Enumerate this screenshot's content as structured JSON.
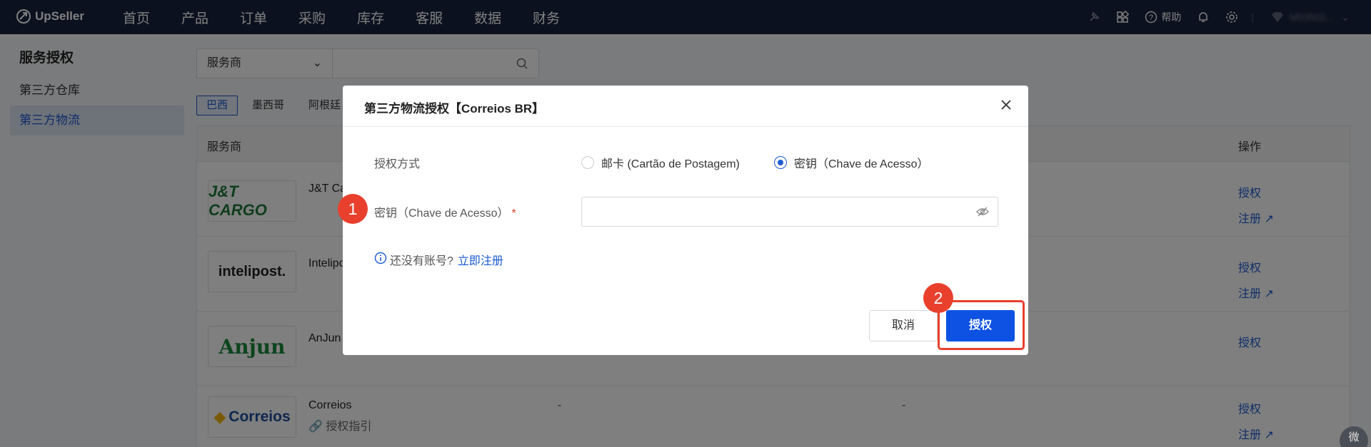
{
  "app": {
    "brand": "UpSeller"
  },
  "topnav": {
    "items": [
      "首页",
      "产品",
      "订单",
      "采购",
      "库存",
      "客服",
      "数据",
      "财务"
    ],
    "help_label": "帮助",
    "account_name": "M03502..."
  },
  "sidebar": {
    "title": "服务授权",
    "items": [
      {
        "label": "第三方仓库",
        "active": false
      },
      {
        "label": "第三方物流",
        "active": true
      }
    ]
  },
  "filter": {
    "select_value": "服务商",
    "search_placeholder": ""
  },
  "country_tabs": [
    "巴西",
    "墨西哥",
    "阿根廷"
  ],
  "table": {
    "headers": {
      "provider": "服务商",
      "operation": "操作"
    },
    "rows": [
      {
        "logo_text": "J&T CARGO",
        "name": "J&T Ca",
        "ops": [
          "授权",
          "注册"
        ]
      },
      {
        "logo_text": "intelipost.",
        "name": "Intelipos",
        "ops": [
          "授权",
          "注册"
        ]
      },
      {
        "logo_text": "Anjun",
        "name": "AnJun",
        "ops": [
          "授权"
        ]
      },
      {
        "logo_text": "Correios",
        "name": "Correios",
        "guide": "授权指引",
        "col2": "-",
        "col3": "-",
        "ops": [
          "授权",
          "注册"
        ]
      }
    ]
  },
  "modal": {
    "title": "第三方物流授权【Correios BR】",
    "auth_method_label": "授权方式",
    "options": [
      {
        "label": "邮卡 (Cartão de Postagem)",
        "selected": false
      },
      {
        "label": "密钥（Chave de Acesso）",
        "selected": true
      }
    ],
    "key_label": "密钥（Chave de Acesso）",
    "required_mark": "*",
    "key_value": "",
    "hint_text": "还没有账号?",
    "hint_link": "立即注册",
    "cancel_label": "取消",
    "submit_label": "授权"
  },
  "annotations": {
    "step1": "1",
    "step2": "2"
  },
  "chat_label": "微",
  "colors": {
    "topbar": "#17233c",
    "accent": "#1a5bd1",
    "primary_button": "#0d52e3",
    "annotation": "#e8402d"
  }
}
